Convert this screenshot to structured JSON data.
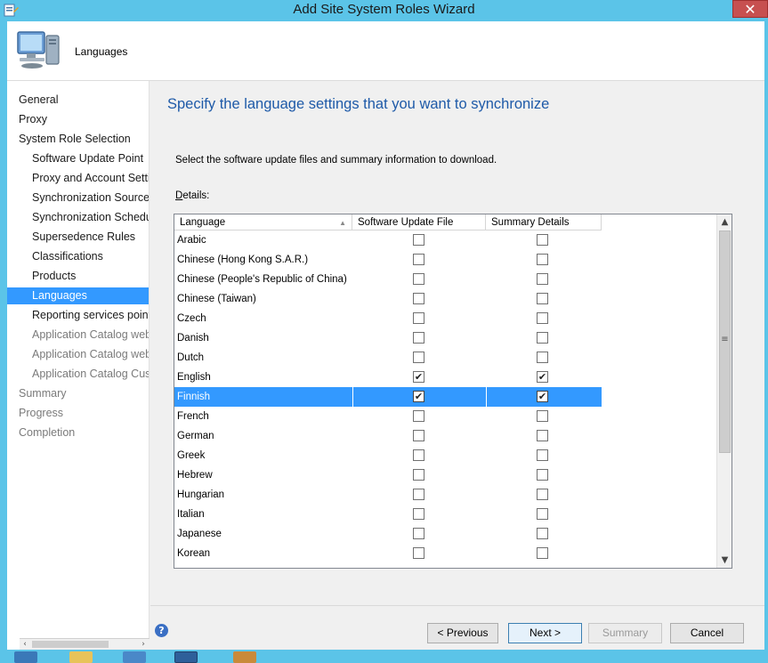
{
  "window": {
    "title": "Add Site System Roles Wizard",
    "close_label": "✕",
    "header_title": "Languages"
  },
  "nav": {
    "items": [
      {
        "label": "General",
        "level": "top",
        "state": "normal"
      },
      {
        "label": "Proxy",
        "level": "top",
        "state": "normal"
      },
      {
        "label": "System Role Selection",
        "level": "top",
        "state": "normal"
      },
      {
        "label": "Software Update Point",
        "level": "sub",
        "state": "normal"
      },
      {
        "label": "Proxy and Account Settin",
        "level": "sub",
        "state": "normal"
      },
      {
        "label": "Synchronization Source",
        "level": "sub",
        "state": "normal"
      },
      {
        "label": "Synchronization Schedule",
        "level": "sub",
        "state": "normal"
      },
      {
        "label": "Supersedence Rules",
        "level": "sub",
        "state": "normal"
      },
      {
        "label": "Classifications",
        "level": "sub",
        "state": "normal"
      },
      {
        "label": "Products",
        "level": "sub",
        "state": "normal"
      },
      {
        "label": "Languages",
        "level": "sub",
        "state": "active"
      },
      {
        "label": "Reporting services point",
        "level": "sub",
        "state": "normal"
      },
      {
        "label": "Application Catalog web",
        "level": "sub",
        "state": "dim"
      },
      {
        "label": "Application Catalog webs",
        "level": "sub",
        "state": "dim"
      },
      {
        "label": "Application Catalog Cust",
        "level": "sub",
        "state": "dim"
      },
      {
        "label": "Summary",
        "level": "top",
        "state": "dim"
      },
      {
        "label": "Progress",
        "level": "top",
        "state": "dim"
      },
      {
        "label": "Completion",
        "level": "top",
        "state": "dim"
      }
    ],
    "scroll_left": "‹",
    "scroll_right": "›",
    "scroll_grip": "|||"
  },
  "content": {
    "heading": "Specify the language settings that you want to synchronize",
    "instruction": "Select the software update files and summary information to download.",
    "details_label_first": "D",
    "details_label_rest": "etails:"
  },
  "grid": {
    "columns": [
      "Language",
      "Software Update File",
      "Summary Details"
    ],
    "check_glyph": "✔",
    "rows": [
      {
        "language": "Arabic",
        "update_file": false,
        "summary": false,
        "selected": false
      },
      {
        "language": "Chinese (Hong Kong S.A.R.)",
        "update_file": false,
        "summary": false,
        "selected": false
      },
      {
        "language": "Chinese (People's Republic of China)",
        "update_file": false,
        "summary": false,
        "selected": false
      },
      {
        "language": "Chinese (Taiwan)",
        "update_file": false,
        "summary": false,
        "selected": false
      },
      {
        "language": "Czech",
        "update_file": false,
        "summary": false,
        "selected": false
      },
      {
        "language": "Danish",
        "update_file": false,
        "summary": false,
        "selected": false
      },
      {
        "language": "Dutch",
        "update_file": false,
        "summary": false,
        "selected": false
      },
      {
        "language": "English",
        "update_file": true,
        "summary": true,
        "selected": false
      },
      {
        "language": "Finnish",
        "update_file": true,
        "summary": true,
        "selected": true
      },
      {
        "language": "French",
        "update_file": false,
        "summary": false,
        "selected": false
      },
      {
        "language": "German",
        "update_file": false,
        "summary": false,
        "selected": false
      },
      {
        "language": "Greek",
        "update_file": false,
        "summary": false,
        "selected": false
      },
      {
        "language": "Hebrew",
        "update_file": false,
        "summary": false,
        "selected": false
      },
      {
        "language": "Hungarian",
        "update_file": false,
        "summary": false,
        "selected": false
      },
      {
        "language": "Italian",
        "update_file": false,
        "summary": false,
        "selected": false
      },
      {
        "language": "Japanese",
        "update_file": false,
        "summary": false,
        "selected": false
      },
      {
        "language": "Korean",
        "update_file": false,
        "summary": false,
        "selected": false
      }
    ],
    "scroll_up": "▲",
    "scroll_down": "▼",
    "scroll_grip": "≡",
    "sort_indicator": "▲"
  },
  "footer": {
    "help_glyph": "?",
    "previous_label": "< Previous",
    "next_label": "Next >",
    "summary_label": "Summary",
    "cancel_label": "Cancel"
  },
  "colors": {
    "titlebar": "#5bc4e8",
    "selection": "#3399ff",
    "heading": "#1e5aa8",
    "close": "#c75050"
  },
  "icons": {
    "app": "wizard-app-icon",
    "header": "computer-monitor-icon",
    "help": "help-icon"
  }
}
